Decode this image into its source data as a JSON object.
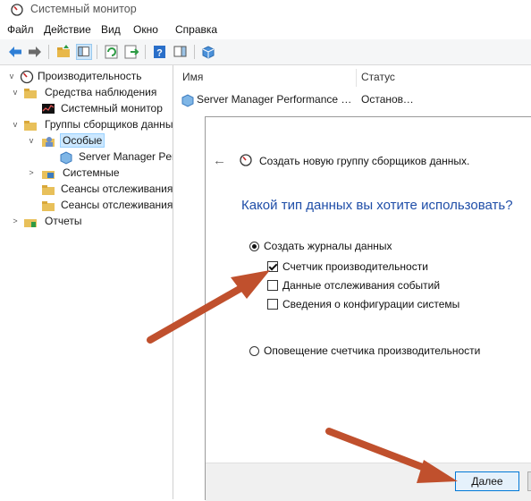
{
  "window": {
    "title": "Системный монитор"
  },
  "menu": [
    "Файл",
    "Действие",
    "Вид",
    "Окно",
    "Справка"
  ],
  "tree": {
    "root": "Производительность",
    "monitoring_tools": "Средства наблюдения",
    "system_monitor": "Системный монитор",
    "collector_sets": "Группы сборщиков данных",
    "user_defined": "Особые",
    "server_manager": "Server Manager Performance Monitor",
    "system": "Системные",
    "event_trace_sessions": "Сеансы отслеживания событий",
    "startup_event_trace": "Сеансы отслеживания событий запуска",
    "reports": "Отчеты"
  },
  "list": {
    "columns": [
      "Имя",
      "Статус"
    ],
    "rows": [
      {
        "name": "Server Manager Performance Monitor",
        "status": "Остановлено"
      }
    ]
  },
  "wizard": {
    "title": "Создать новую группу сборщиков данных.",
    "question": "Какой тип данных вы хотите использовать?",
    "option_create_logs": "Создать журналы данных",
    "cb_perf_counter": "Счетчик производительности",
    "cb_event_trace": "Данные отслеживания событий",
    "cb_sys_config": "Сведения о конфигурации системы",
    "option_perf_alert": "Оповещение счетчика производительности",
    "next_button": "Далее",
    "state": {
      "create_logs_selected": true,
      "perf_counter_checked": true,
      "event_trace_checked": false,
      "sys_config_checked": false,
      "perf_alert_selected": false
    }
  },
  "colors": {
    "accent": "#1f4ea8",
    "arrow": "#c0502d",
    "selection": "#cce8ff"
  }
}
